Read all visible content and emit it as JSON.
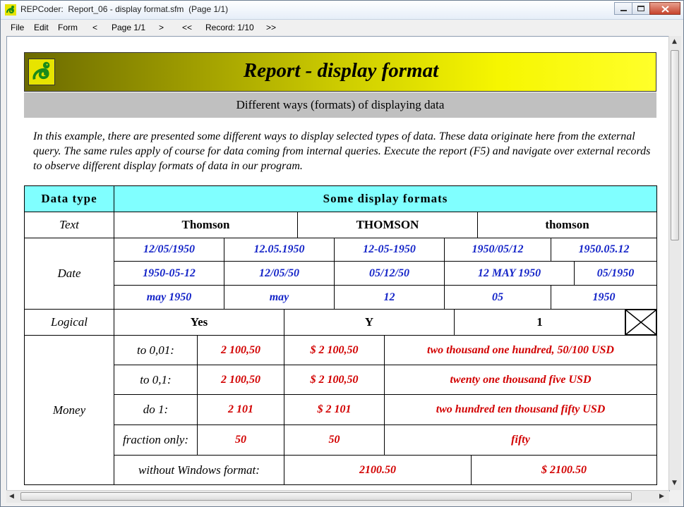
{
  "window": {
    "title": "REPCoder:  Report_06 - display format.sfm  (Page 1/1)"
  },
  "menu": {
    "file": "File",
    "edit": "Edit",
    "form": "Form",
    "prev": "<",
    "page": "Page 1/1",
    "next": ">",
    "first": "<<",
    "record": "Record: 1/10",
    "last": ">>"
  },
  "report": {
    "title": "Report - display format",
    "subtitle": "Different ways (formats) of displaying data",
    "description": "In this example, there are presented some different ways to display selected types of data. These data originate here from the external query. The same rules apply of course for data coming from internal queries. Execute the report (F5) and navigate over external records to observe different display formats of data in our program."
  },
  "table": {
    "header_type": "Data type",
    "header_formats": "Some display formats",
    "text": {
      "label": "Text",
      "values": [
        "Thomson",
        "THOMSON",
        "thomson"
      ]
    },
    "date": {
      "label": "Date",
      "row1": [
        "12/05/1950",
        "12.05.1950",
        "12-05-1950",
        "1950/05/12",
        "1950.05.12"
      ],
      "row2": [
        "1950-05-12",
        "12/05/50",
        "05/12/50",
        "12 MAY 1950",
        "05/1950"
      ],
      "row3": [
        "may 1950",
        "may",
        "12",
        "05",
        "1950"
      ]
    },
    "logical": {
      "label": "Logical",
      "values": [
        "Yes",
        "Y",
        "1"
      ],
      "checkbox_checked": true
    },
    "money": {
      "label": "Money",
      "rows": [
        {
          "label": "to 0,01:",
          "v1": "2 100,50",
          "v2": "$ 2 100,50",
          "words": "two thousand one hundred, 50/100 USD"
        },
        {
          "label": "to 0,1:",
          "v1": "2 100,50",
          "v2": "$ 2 100,50",
          "words": "twenty one thousand five USD"
        },
        {
          "label": "do 1:",
          "v1": "2 101",
          "v2": "$ 2 101",
          "words": "two hundred ten thousand fifty USD"
        },
        {
          "label": "fraction only:",
          "v1": "50",
          "v2": "50",
          "words": "fifty"
        }
      ],
      "nowin": {
        "label": "without Windows format:",
        "v1": "2100.50",
        "v2": "$ 2100.50"
      }
    }
  },
  "colors": {
    "header_bg": "#80ffff",
    "date_blue": "#1424c8",
    "money_red": "#d20000",
    "subtitle_bg": "#c0c0c0"
  }
}
